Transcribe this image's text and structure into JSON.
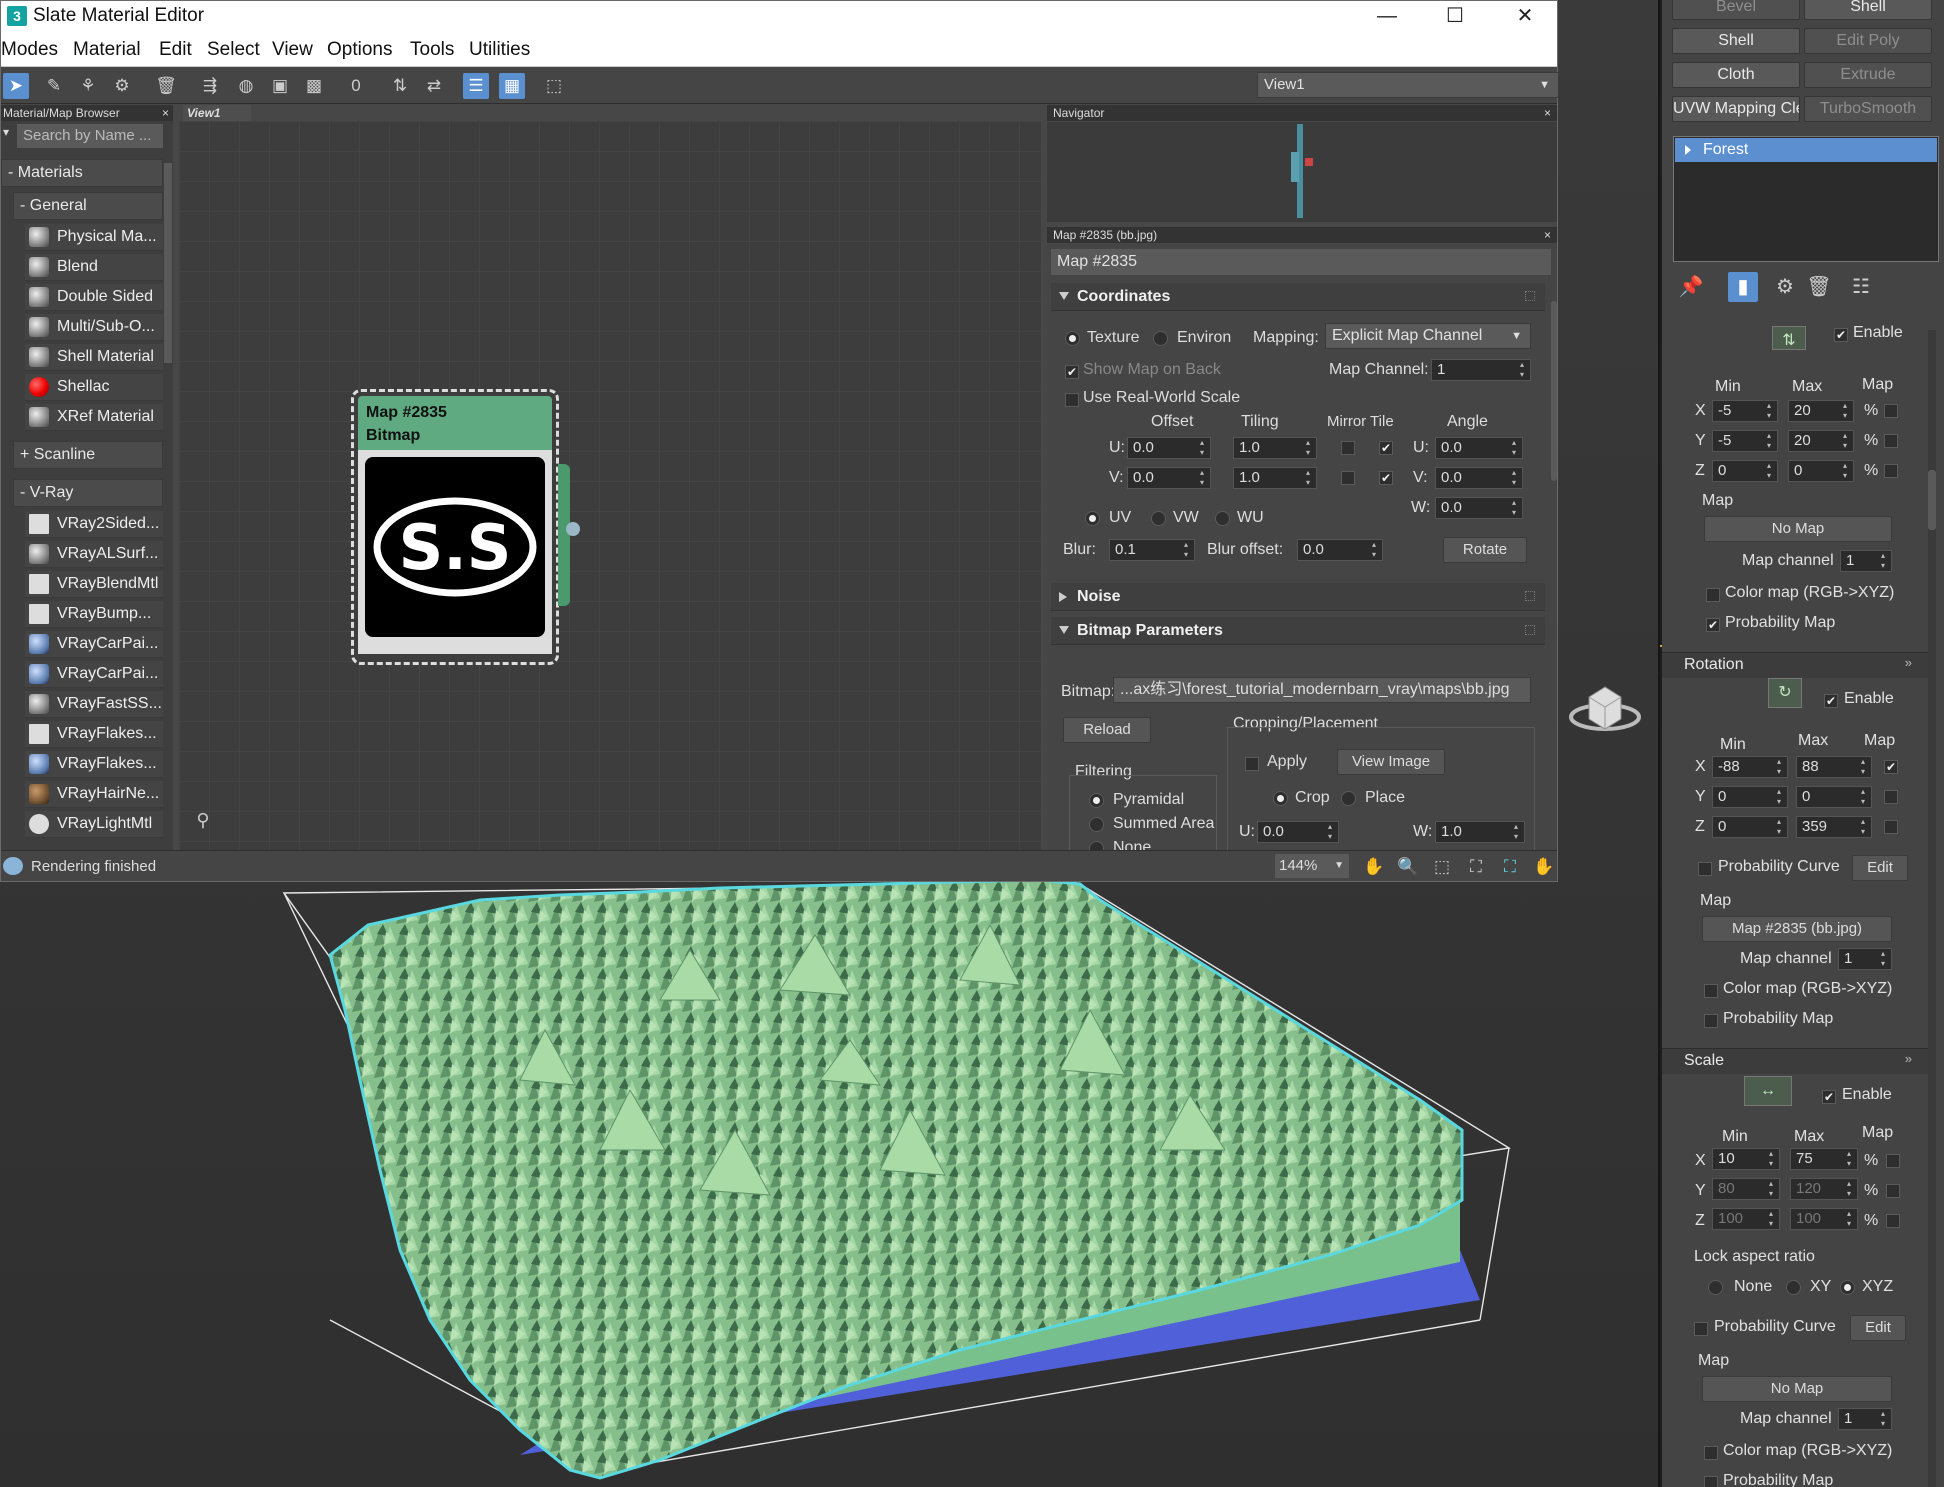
{
  "window": {
    "title": "Slate Material Editor",
    "icon": "3",
    "controls": {
      "minimize": "—",
      "maximize": "☐",
      "close": "✕"
    }
  },
  "menu": [
    "Modes",
    "Material",
    "Edit",
    "Select",
    "View",
    "Options",
    "Tools",
    "Utilities"
  ],
  "toolbar": {
    "view_selector": "View1",
    "icons": [
      "select-arrow-icon",
      "eyedropper-icon",
      "pick-material-icon",
      "put-to-scene-icon",
      "delete-icon",
      "move-children-icon",
      "hide-unused-icon",
      "layout-all-icon",
      "layout-children-icon",
      "show-background-icon",
      "material-id-icon",
      "show-map-in-viewport-icon",
      "show-end-result-icon",
      "navigator-toggle-icon",
      "parameter-editor-toggle-icon",
      "select-by-material-icon"
    ]
  },
  "browser": {
    "title": "Material/Map Browser",
    "search_placeholder": "Search by Name ...",
    "materials_label": "Materials",
    "general_label": "General",
    "general_items": [
      "Physical Ma...",
      "Blend",
      "Double Sided",
      "Multi/Sub-O...",
      "Shell Material",
      "Shellac",
      "XRef Material"
    ],
    "scanline_label": "+ Scanline",
    "vray_label": "V-Ray",
    "vray_items": [
      "VRay2Sided...",
      "VRayALSurf...",
      "VRayBlendMtl",
      "VRayBump...",
      "VRayCarPai...",
      "VRayCarPai...",
      "VRayFastSS...",
      "VRayFlakes...",
      "VRayFlakes...",
      "VRayHairNe...",
      "VRayLightMtl"
    ]
  },
  "view": {
    "tab": "View1",
    "node": {
      "title": "Map #2835",
      "subtitle": "Bitmap",
      "logo": "S.S"
    }
  },
  "navigator": {
    "title": "Navigator"
  },
  "params": {
    "title": "Map #2835 (bb.jpg)",
    "map_name": "Map #2835",
    "coordinates": {
      "header": "Coordinates",
      "texture": "Texture",
      "environ": "Environ",
      "mapping_label": "Mapping:",
      "mapping_value": "Explicit Map Channel",
      "show_map_on_back": "Show Map on Back",
      "map_channel_label": "Map Channel:",
      "map_channel_value": "1",
      "real_world": "Use Real-World Scale",
      "offset_label": "Offset",
      "tiling_label": "Tiling",
      "mirror_tile_label": "Mirror Tile",
      "angle_label": "Angle",
      "u_label": "U:",
      "v_label": "V:",
      "w_label": "W:",
      "u_offset": "0.0",
      "v_offset": "0.0",
      "u_tiling": "1.0",
      "v_tiling": "1.0",
      "u_angle": "0.0",
      "v_angle": "0.0",
      "w_angle": "0.0",
      "uv": "UV",
      "vw": "VW",
      "wu": "WU",
      "blur_label": "Blur:",
      "blur_value": "0.1",
      "blur_offset_label": "Blur offset:",
      "blur_offset_value": "0.0",
      "rotate": "Rotate"
    },
    "noise": {
      "header": "Noise"
    },
    "bitmap_params": {
      "header": "Bitmap Parameters",
      "bitmap_label": "Bitmap:",
      "bitmap_path": "...ax练习\\forest_tutorial_modernbarn_vray\\maps\\bb.jpg",
      "reload": "Reload",
      "cropping_label": "Cropping/Placement",
      "apply": "Apply",
      "view_image": "View Image",
      "crop": "Crop",
      "place": "Place",
      "u_label": "U:",
      "u_value": "0.0",
      "w_label": "W:",
      "w_value": "1.0",
      "filtering_label": "Filtering",
      "pyramidal": "Pyramidal",
      "summed_area": "Summed Area",
      "none": "None"
    }
  },
  "status": {
    "text": "Rendering finished",
    "zoom": "144%"
  },
  "command_panel": {
    "buttons": [
      [
        "Bevel",
        "Shell"
      ],
      [
        "Shell",
        "Edit Poly"
      ],
      [
        "Cloth",
        "Extrude"
      ],
      [
        "UVW Mapping Clea",
        "TurboSmooth"
      ]
    ],
    "stack_item": "Forest",
    "top": {
      "enable": "Enable",
      "min": "Min",
      "max": "Max",
      "map": "Map",
      "x_min": "-5",
      "x_max": "20",
      "y_min": "-5",
      "y_max": "20",
      "z_min": "0",
      "z_max": "0",
      "pct": "%",
      "map_label": "Map",
      "no_map": "No Map",
      "map_channel_label": "Map channel",
      "map_channel_value": "1",
      "color_map": "Color map (RGB->XYZ)",
      "probability_map": "Probability Map"
    },
    "rotation": {
      "header": "Rotation",
      "enable": "Enable",
      "min": "Min",
      "max": "Max",
      "map": "Map",
      "x_min": "-88",
      "x_max": "88",
      "y_min": "0",
      "y_max": "0",
      "z_min": "0",
      "z_max": "359",
      "probability_curve": "Probability Curve",
      "edit": "Edit",
      "map_label": "Map",
      "map_button": "Map #2835 (bb.jpg)",
      "map_channel_label": "Map channel",
      "map_channel_value": "1",
      "color_map": "Color map (RGB->XYZ)",
      "probability_map": "Probability Map"
    },
    "scale": {
      "header": "Scale",
      "enable": "Enable",
      "min": "Min",
      "max": "Max",
      "map": "Map",
      "x_min": "10",
      "x_max": "75",
      "y_min": "80",
      "y_max": "120",
      "z_min": "100",
      "z_max": "100",
      "pct": "%",
      "lock_aspect": "Lock aspect ratio",
      "none": "None",
      "xy": "XY",
      "xyz": "XYZ",
      "probability_curve": "Probability Curve",
      "edit": "Edit",
      "map_label": "Map",
      "no_map": "No Map",
      "map_channel_label": "Map channel",
      "map_channel_value": "1",
      "color_map": "Color map (RGB->XYZ)",
      "probability_map": "Probability Map"
    },
    "axis_x": "X",
    "axis_y": "Y",
    "axis_z": "Z"
  },
  "viewport": {
    "colors": {
      "terrain": "#8fc895",
      "edge": "#5ad8e0",
      "underside": "#5060d8",
      "bbox": "#e8e8e8"
    }
  }
}
